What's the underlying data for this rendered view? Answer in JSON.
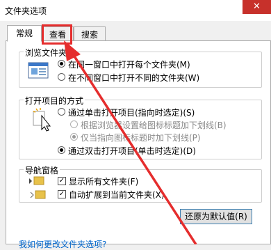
{
  "window": {
    "title": "文件夹选项",
    "close_glyph": "✕"
  },
  "tabs": [
    {
      "label": "常规",
      "active": true
    },
    {
      "label": "查看",
      "active": false
    },
    {
      "label": "搜索",
      "active": false
    }
  ],
  "browse": {
    "legend": "浏览文件夹",
    "options": [
      {
        "label": "在同一窗口中打开每个文件夹(M)",
        "selected": true
      },
      {
        "label": "在不同窗口中打开不同的文件夹(W)",
        "selected": false
      }
    ]
  },
  "open_items": {
    "legend": "打开项目的方式",
    "options": [
      {
        "label": "通过单击打开项目(指向时选定)(S)",
        "selected": false,
        "enabled": true
      },
      {
        "label": "根据浏览器设置给图标标题加下划线(B)",
        "selected": false,
        "enabled": false
      },
      {
        "label": "仅当指向图标标题时加下划线(P)",
        "selected": true,
        "enabled": false
      },
      {
        "label": "通过双击打开项目(单击时选定)(D)",
        "selected": true,
        "enabled": true
      }
    ]
  },
  "nav_pane": {
    "legend": "导航窗格",
    "options": [
      {
        "label": "显示所有文件夹(F)",
        "checked": true
      },
      {
        "label": "自动扩展到当前文件夹(X)",
        "checked": true
      }
    ]
  },
  "restore_button": "还原为默认值(R)",
  "help_link": "我如何更改文件夹选项?",
  "colors": {
    "annotation": "#e52d2d",
    "close": "#c7312b",
    "link": "#0066cc"
  }
}
